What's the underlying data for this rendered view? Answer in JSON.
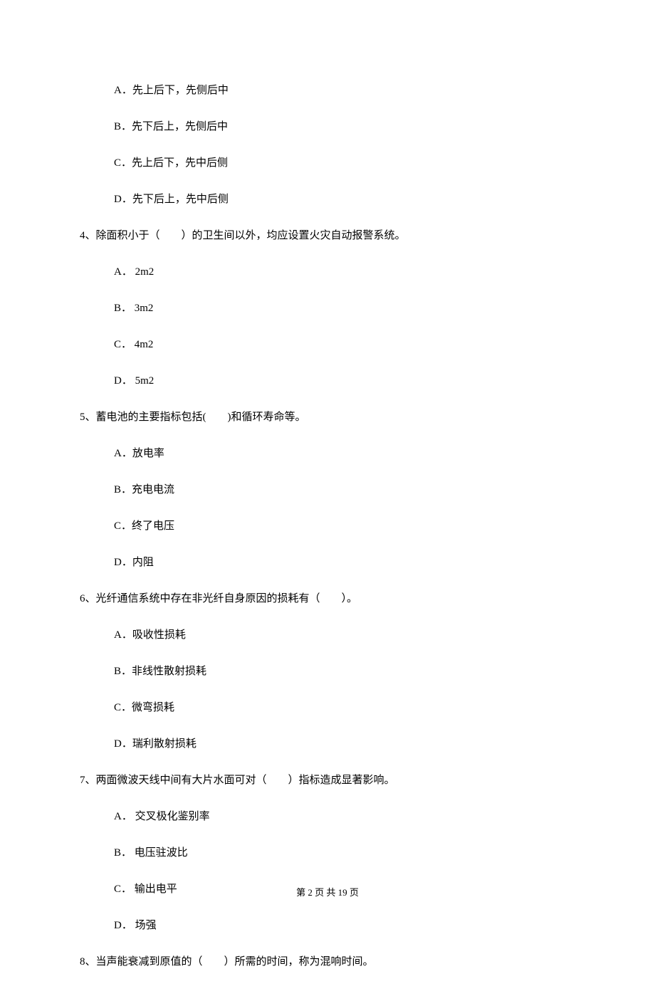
{
  "q3": {
    "optA": "A．先上后下，先侧后中",
    "optB": "B．先下后上，先侧后中",
    "optC": "C．先上后下，先中后侧",
    "optD": "D．先下后上，先中后侧"
  },
  "q4": {
    "stem": "4、除面积小于（　　）的卫生间以外，均应设置火灾自动报警系统。",
    "optA": "A． 2m2",
    "optB": "B． 3m2",
    "optC": "C． 4m2",
    "optD": "D． 5m2"
  },
  "q5": {
    "stem": "5、蓄电池的主要指标包括(　　)和循环寿命等。",
    "optA": "A．放电率",
    "optB": "B．充电电流",
    "optC": "C．终了电压",
    "optD": "D．内阻"
  },
  "q6": {
    "stem": "6、光纤通信系统中存在非光纤自身原因的损耗有（　　）。",
    "optA": "A．吸收性损耗",
    "optB": "B．非线性散射损耗",
    "optC": "C．微弯损耗",
    "optD": "D．瑞利散射损耗"
  },
  "q7": {
    "stem": "7、两面微波天线中间有大片水面可对（　　）指标造成显著影响。",
    "optA": "A． 交叉极化鉴别率",
    "optB": "B． 电压驻波比",
    "optC": "C． 输出电平",
    "optD": "D． 场强"
  },
  "q8": {
    "stem": "8、当声能衰减到原值的（　　）所需的时间，称为混响时间。"
  },
  "footer": "第 2 页 共 19 页"
}
